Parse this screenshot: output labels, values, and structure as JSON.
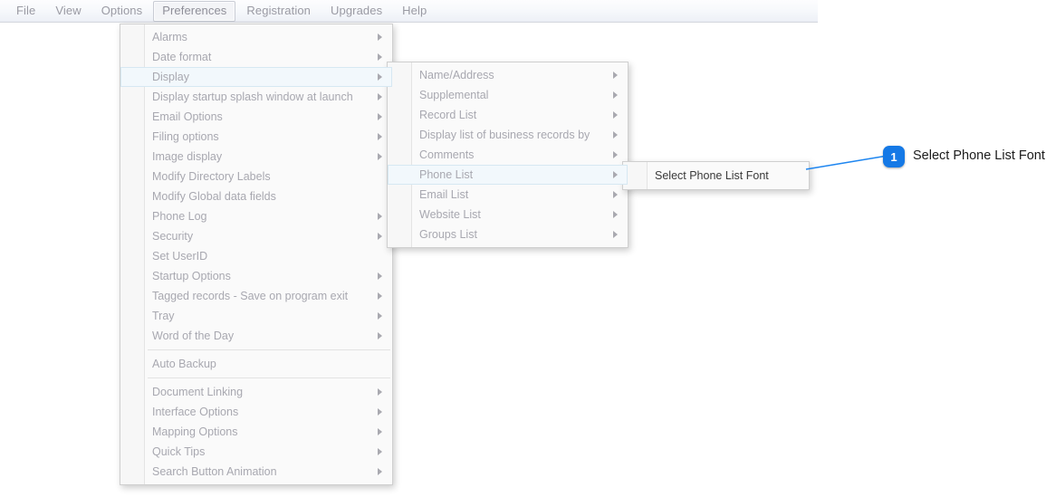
{
  "menubar": {
    "items": [
      {
        "label": "File",
        "active": false
      },
      {
        "label": "View",
        "active": false
      },
      {
        "label": "Options",
        "active": false
      },
      {
        "label": "Preferences",
        "active": true
      },
      {
        "label": "Registration",
        "active": false
      },
      {
        "label": "Upgrades",
        "active": false
      },
      {
        "label": "Help",
        "active": false
      }
    ]
  },
  "menu_preferences": {
    "items": [
      {
        "label": "Alarms",
        "arrow": true
      },
      {
        "label": "Date format",
        "arrow": true
      },
      {
        "label": "Display",
        "arrow": true,
        "highlight": true
      },
      {
        "label": "Display startup splash window at launch",
        "arrow": true
      },
      {
        "label": "Email Options",
        "arrow": true
      },
      {
        "label": "Filing options",
        "arrow": true
      },
      {
        "label": "Image display",
        "arrow": true
      },
      {
        "label": "Modify Directory Labels",
        "arrow": false
      },
      {
        "label": "Modify Global data fields",
        "arrow": false
      },
      {
        "label": "Phone Log",
        "arrow": true
      },
      {
        "label": "Security",
        "arrow": true
      },
      {
        "label": "Set UserID",
        "arrow": false
      },
      {
        "label": "Startup Options",
        "arrow": true
      },
      {
        "label": "Tagged records - Save on program exit",
        "arrow": true
      },
      {
        "label": "Tray",
        "arrow": true
      },
      {
        "label": "Word of the Day",
        "arrow": true
      },
      {
        "separator": true
      },
      {
        "label": "Auto Backup",
        "arrow": false
      },
      {
        "separator": true
      },
      {
        "label": "Document Linking",
        "arrow": true
      },
      {
        "label": "Interface Options",
        "arrow": true
      },
      {
        "label": "Mapping Options",
        "arrow": true
      },
      {
        "label": "Quick Tips",
        "arrow": true
      },
      {
        "label": "Search Button Animation",
        "arrow": true
      }
    ]
  },
  "menu_display": {
    "items": [
      {
        "label": "Name/Address",
        "arrow": true
      },
      {
        "label": "Supplemental",
        "arrow": true
      },
      {
        "label": "Record List",
        "arrow": true
      },
      {
        "label": "Display list of business records by",
        "arrow": true
      },
      {
        "label": "Comments",
        "arrow": true
      },
      {
        "label": "Phone List",
        "arrow": true,
        "highlight": true
      },
      {
        "label": "Email List",
        "arrow": true
      },
      {
        "label": "Website List",
        "arrow": true
      },
      {
        "label": "Groups List",
        "arrow": true
      }
    ]
  },
  "menu_phone_list": {
    "items": [
      {
        "label": "Select Phone List Font",
        "arrow": false,
        "dark": true
      }
    ]
  },
  "annotation": {
    "number": "1",
    "label": "Select Phone List Font",
    "accent_color": "#1579e6"
  }
}
